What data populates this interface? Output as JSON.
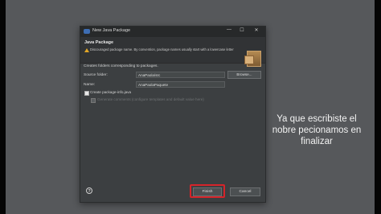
{
  "dialog": {
    "title": "New Java Package",
    "header_title": "Java Package",
    "header_message": "Discouraged package name. By convention, package names usually start with a lowercase letter",
    "description": "Creates folders corresponding to packages.",
    "source_folder_label": "Source folder:",
    "source_folder_value": "AnaPaola/src",
    "browse_label": "Browse...",
    "name_label": "Name:",
    "name_value": "AnaPaolaPaquete",
    "create_package_info_label": "Create package-info.java",
    "generate_comments_label": "Generate comments (configure templates and default value here)",
    "finish_label": "Finish",
    "cancel_label": "Cancel",
    "help_glyph": "?",
    "window_controls": {
      "minimize": "—",
      "maximize": "☐",
      "close": "✕"
    }
  },
  "caption": "Ya que escribiste el nobre pecionamos en finalizar",
  "colors": {
    "background": "#56585b",
    "dialog": "#3c3f41",
    "highlight": "#d6242a",
    "warning": "#e0a526"
  }
}
